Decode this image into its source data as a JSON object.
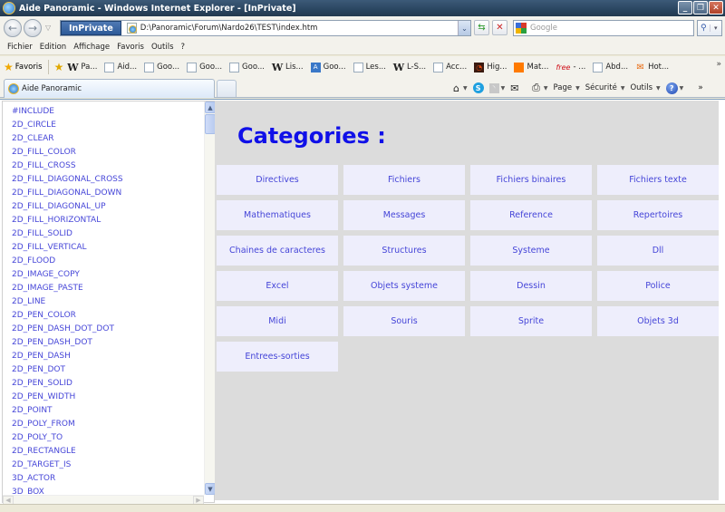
{
  "window": {
    "title": "Aide Panoramic - Windows Internet Explorer - [InPrivate]",
    "controls": [
      "minimize",
      "restore",
      "close"
    ]
  },
  "address_bar": {
    "inprivate_label": "InPrivate",
    "url": "D:\\Panoramic\\Forum\\Nardo26\\TEST\\index.htm",
    "search_placeholder": "Google"
  },
  "menu": {
    "items": [
      "Fichier",
      "Edition",
      "Affichage",
      "Favoris",
      "Outils",
      "?"
    ]
  },
  "favorites_bar": {
    "label": "Favoris",
    "links": [
      {
        "icon": "wikipedia-icon",
        "label": "Pa..."
      },
      {
        "icon": "ie-page-icon",
        "label": "Aid..."
      },
      {
        "icon": "ie-page-icon",
        "label": "Goo..."
      },
      {
        "icon": "ie-page-icon",
        "label": "Goo..."
      },
      {
        "icon": "ie-page-icon",
        "label": "Goo..."
      },
      {
        "icon": "wikipedia-icon",
        "label": "Lis..."
      },
      {
        "icon": "translate-icon",
        "label": "Goo..."
      },
      {
        "icon": "ie-page-icon",
        "label": "Les..."
      },
      {
        "icon": "wikipedia-icon",
        "label": "L-S..."
      },
      {
        "icon": "ie-page-icon",
        "label": "Acc..."
      },
      {
        "icon": "ubuntu-icon",
        "label": "Hig..."
      },
      {
        "icon": "orange-icon",
        "label": "Mat..."
      },
      {
        "icon": "free-icon",
        "label": "- ..."
      },
      {
        "icon": "ie-page-icon",
        "label": "Abd..."
      },
      {
        "icon": "hotmail-icon",
        "label": "Hot..."
      }
    ]
  },
  "tab": {
    "label": "Aide Panoramic"
  },
  "command_bar": {
    "page_label": "Page",
    "security_label": "Sécurité",
    "tools_label": "Outils"
  },
  "sidebar": {
    "commands": [
      "#INCLUDE",
      "2D_CIRCLE",
      "2D_CLEAR",
      "2D_FILL_COLOR",
      "2D_FILL_CROSS",
      "2D_FILL_DIAGONAL_CROSS",
      "2D_FILL_DIAGONAL_DOWN",
      "2D_FILL_DIAGONAL_UP",
      "2D_FILL_HORIZONTAL",
      "2D_FILL_SOLID",
      "2D_FILL_VERTICAL",
      "2D_FLOOD",
      "2D_IMAGE_COPY",
      "2D_IMAGE_PASTE",
      "2D_LINE",
      "2D_PEN_COLOR",
      "2D_PEN_DASH_DOT_DOT",
      "2D_PEN_DASH_DOT",
      "2D_PEN_DASH",
      "2D_PEN_DOT",
      "2D_PEN_SOLID",
      "2D_PEN_WIDTH",
      "2D_POINT",
      "2D_POLY_FROM",
      "2D_POLY_TO",
      "2D_RECTANGLE",
      "2D_TARGET_IS",
      "3D_ACTOR",
      "3D_BOX"
    ]
  },
  "main": {
    "title": "Categories :",
    "categories": [
      "Directives",
      "Fichiers",
      "Fichiers binaires",
      "Fichiers texte",
      "Mathematiques",
      "Messages",
      "Reference",
      "Repertoires",
      "Chaines de caracteres",
      "Structures",
      "Systeme",
      "Dll",
      "Excel",
      "Objets systeme",
      "Dessin",
      "Police",
      "Midi",
      "Souris",
      "Sprite",
      "Objets 3d",
      "Entrees-sorties"
    ]
  },
  "colors": {
    "link": "#4646d8",
    "title": "#1010e8",
    "category_bg": "#eeeefc",
    "content_bg": "#dcdcdc"
  }
}
